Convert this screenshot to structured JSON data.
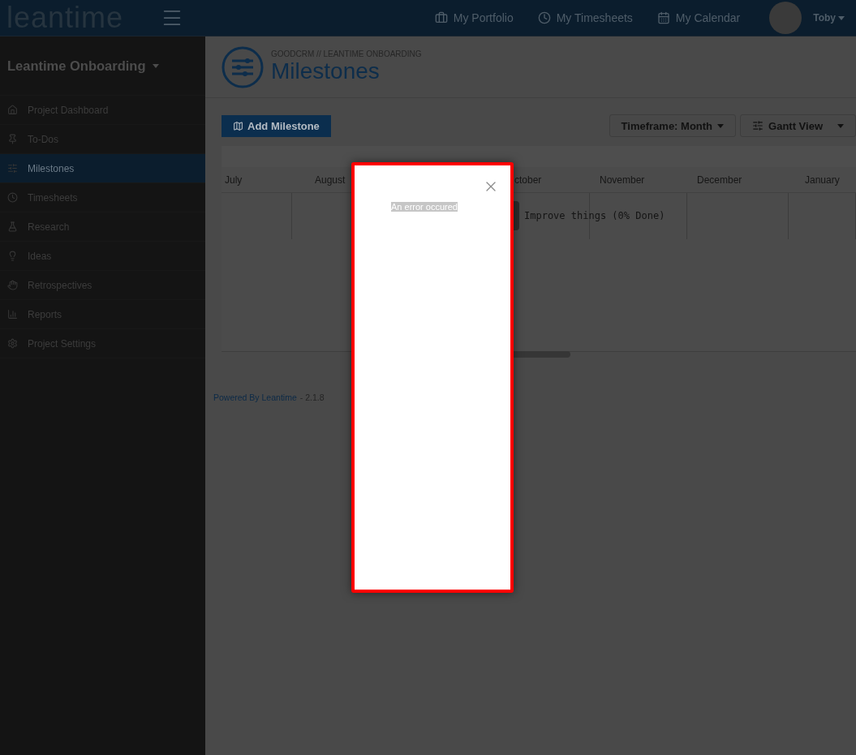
{
  "header": {
    "logo": "leantime",
    "nav": [
      {
        "label": "My Portfolio",
        "kind": "portfolio"
      },
      {
        "label": "My Timesheets",
        "kind": "timesheets"
      },
      {
        "label": "My Calendar",
        "kind": "calendar"
      }
    ],
    "user": "Toby"
  },
  "sidebar": {
    "project": "Leantime Onboarding",
    "items": [
      {
        "label": "Project Dashboard",
        "kind": "dashboard",
        "selected": false
      },
      {
        "label": "To-Dos",
        "kind": "todos",
        "selected": false
      },
      {
        "label": "Milestones",
        "kind": "milestones",
        "selected": true
      },
      {
        "label": "Timesheets",
        "kind": "timesheets",
        "selected": false
      },
      {
        "label": "Research",
        "kind": "research",
        "selected": false
      },
      {
        "label": "Ideas",
        "kind": "ideas",
        "selected": false
      },
      {
        "label": "Retrospectives",
        "kind": "retros",
        "selected": false
      },
      {
        "label": "Reports",
        "kind": "reports",
        "selected": false
      },
      {
        "label": "Project Settings",
        "kind": "settings",
        "selected": false
      }
    ]
  },
  "page": {
    "breadcrumb": "GOODCRM // LEANTIME ONBOARDING",
    "title": "Milestones"
  },
  "toolbar": {
    "add_button": "Add Milestone",
    "timeframe": "Timeframe: Month",
    "view": "Gantt View"
  },
  "gantt": {
    "months": [
      {
        "label": "July"
      },
      {
        "label": "August"
      },
      {
        "label": "ctober"
      },
      {
        "label": "November"
      },
      {
        "label": "December"
      },
      {
        "label": "January"
      }
    ],
    "task": "Improve things (0% Done)"
  },
  "footer": {
    "link": "Powered By Leantime",
    "version": "- 2.1.8"
  },
  "modal": {
    "message": "An error occured"
  }
}
